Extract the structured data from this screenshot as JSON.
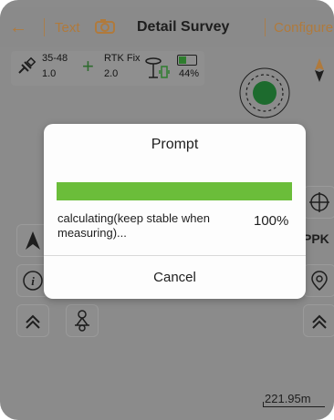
{
  "header": {
    "back_label": "←",
    "text_link": "Text",
    "title": "Detail Survey",
    "configure_link": "Configure"
  },
  "status": {
    "sats": "35-48",
    "pdop": "1.0",
    "fix_type": "RTK Fix",
    "age": "2.0",
    "battery_pct": "44%",
    "battery_level": 0.44
  },
  "side": {
    "ppk_label": "PPK"
  },
  "map": {
    "scale_label": "221.95m"
  },
  "dialog": {
    "title": "Prompt",
    "progress_fraction": 1.0,
    "message": "calculating(keep stable when measuring)...",
    "percent": "100%",
    "cancel_label": "Cancel"
  },
  "colors": {
    "accent": "#b07a3c",
    "progress": "#6bbd3a",
    "overlay": "#8b8b8b"
  }
}
